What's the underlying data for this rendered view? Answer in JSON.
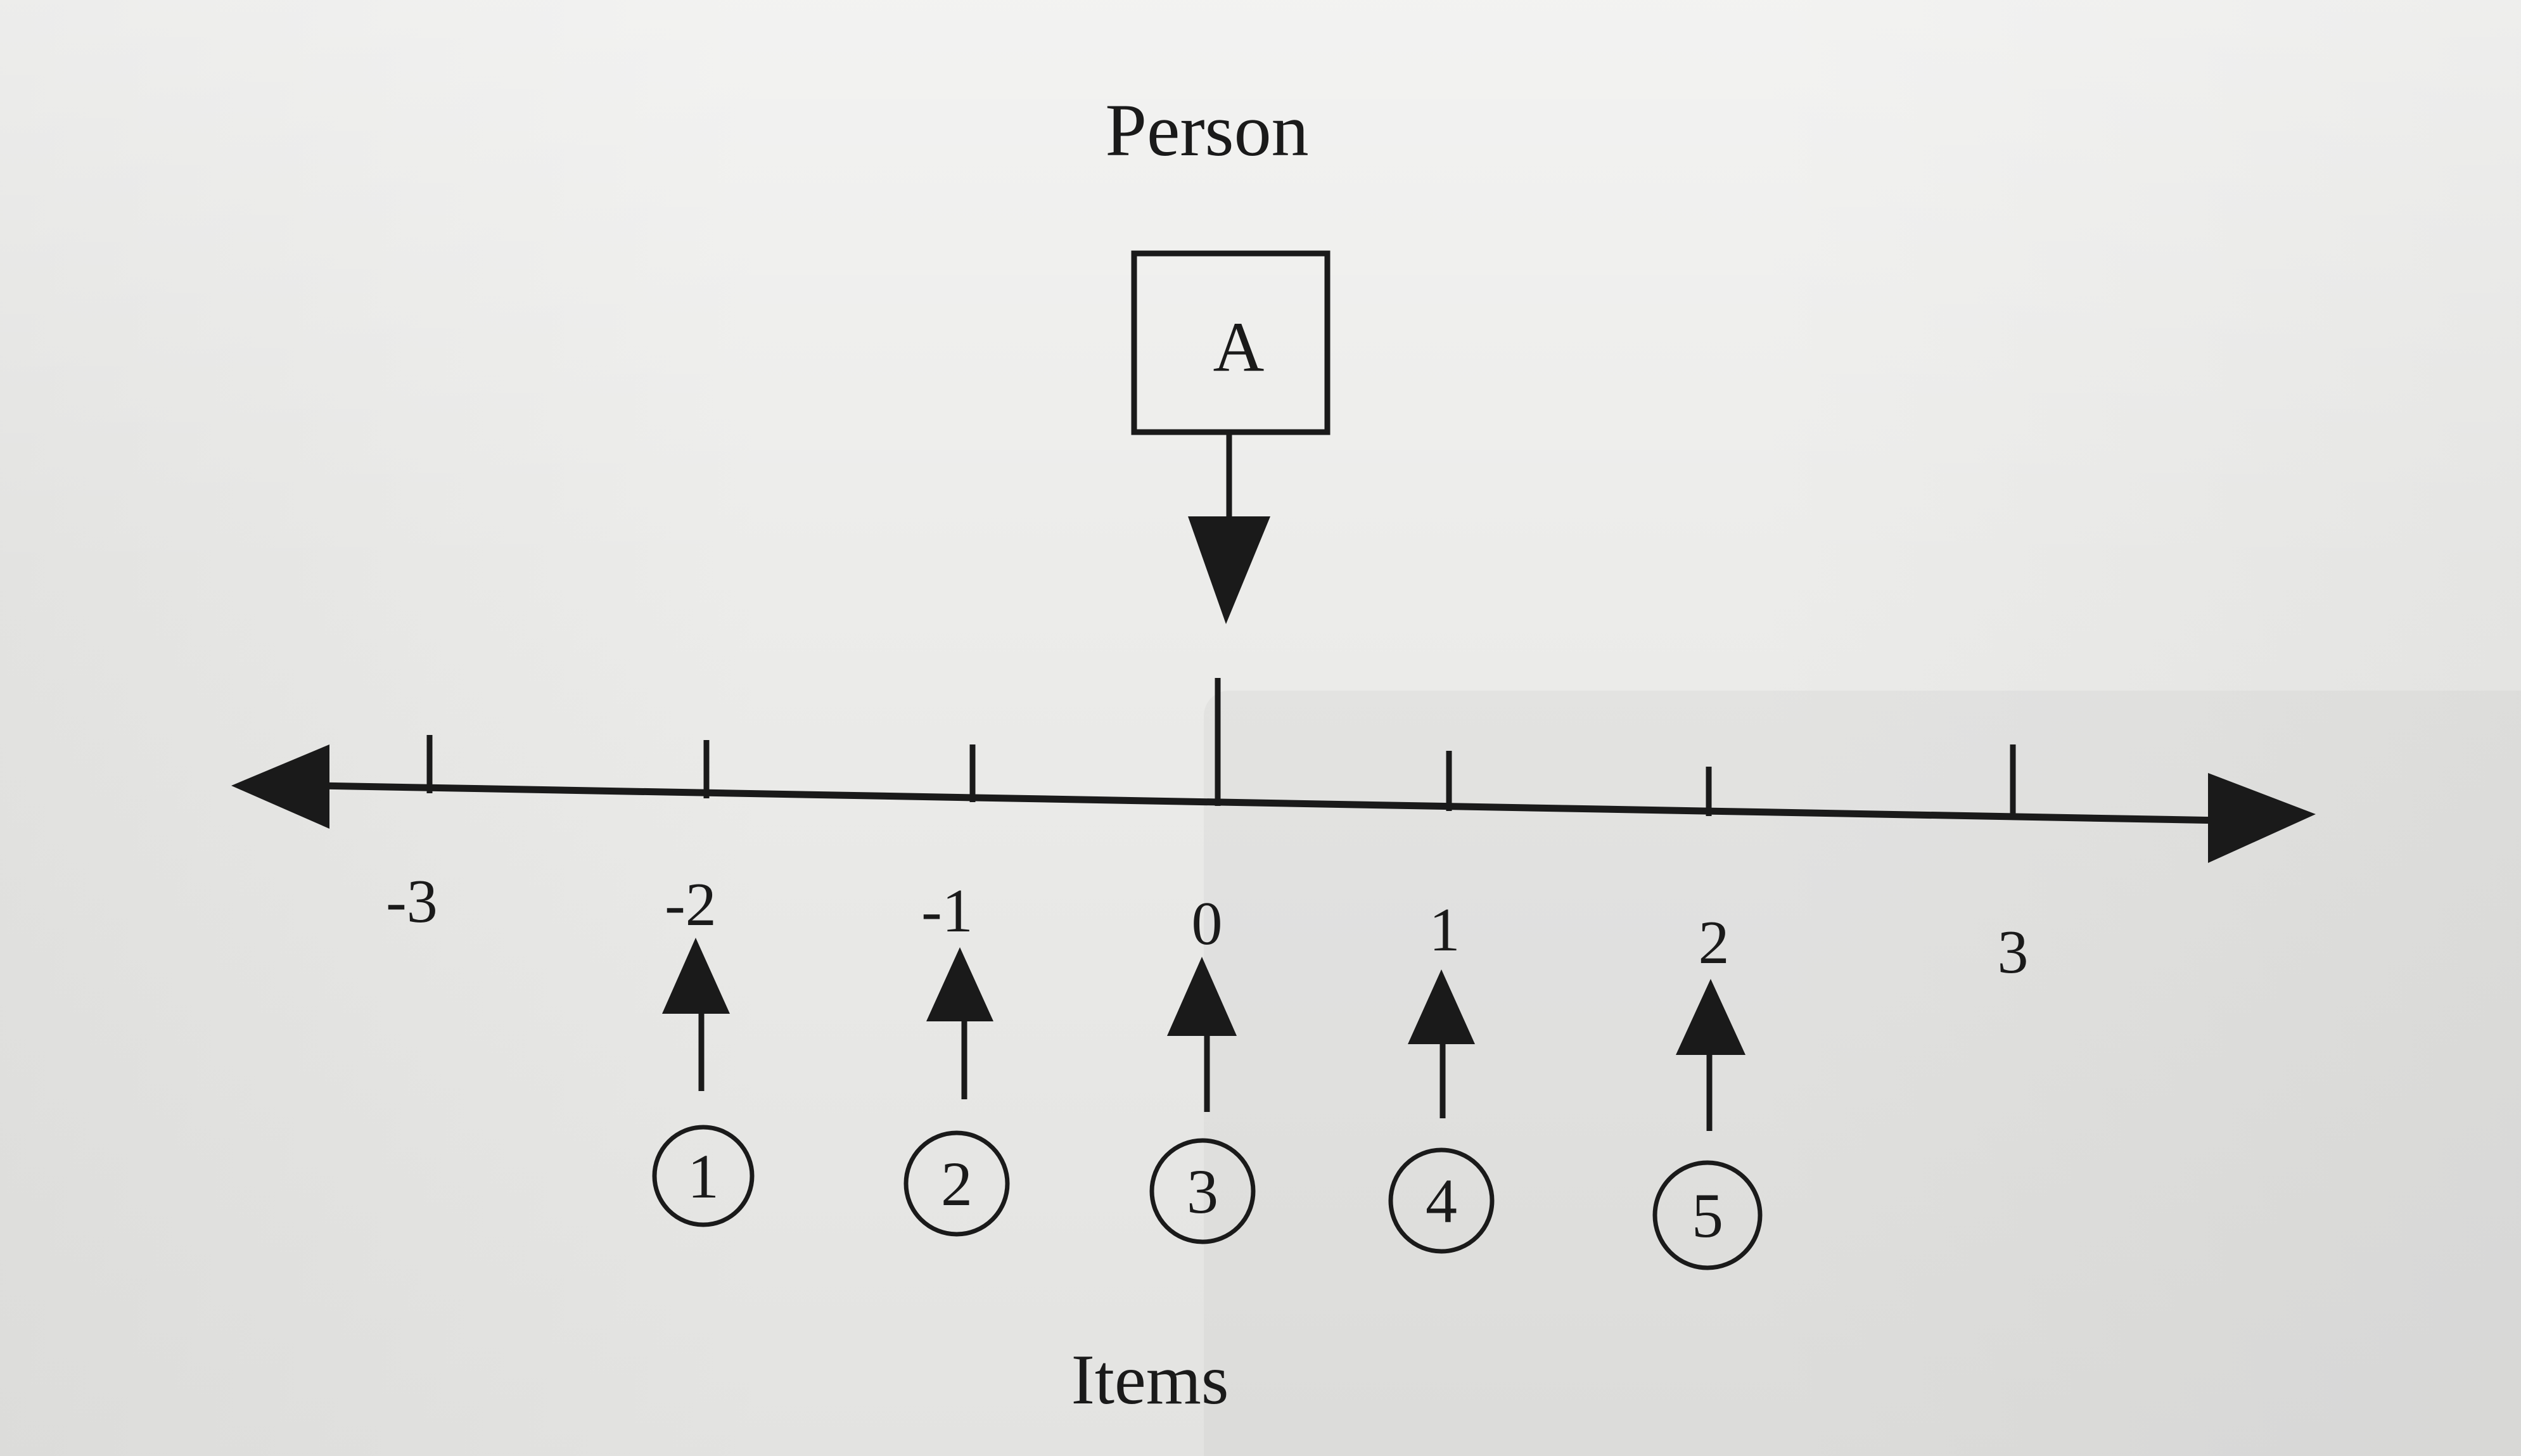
{
  "heading_top": "Person",
  "person_label": "A",
  "heading_bottom": "Items",
  "axis_ticks": [
    "-3",
    "-2",
    "-1",
    "0",
    "1",
    "2",
    "3"
  ],
  "items": [
    {
      "label": "1",
      "position": -2
    },
    {
      "label": "2",
      "position": -1
    },
    {
      "label": "3",
      "position": 0
    },
    {
      "label": "4",
      "position": 1
    },
    {
      "label": "5",
      "position": 2
    }
  ],
  "person_position": 0
}
